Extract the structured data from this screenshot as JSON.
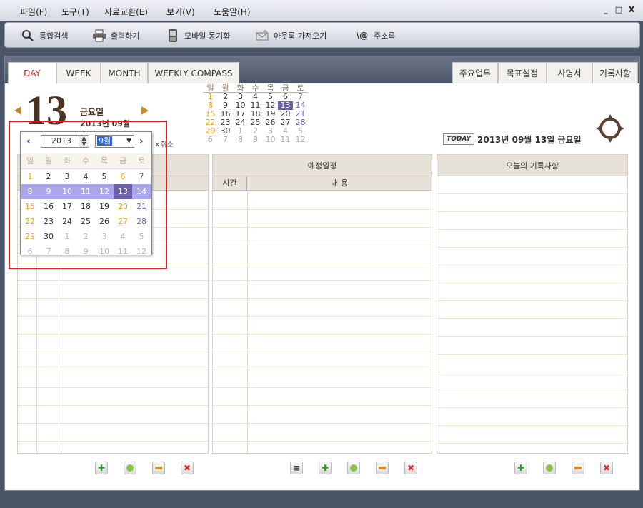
{
  "menubar": {
    "items": [
      "파일(F)",
      "도구(T)",
      "자료교환(E)",
      "보기(V)",
      "도움말(H)"
    ],
    "controls": [
      "_",
      "□",
      "X"
    ]
  },
  "toolbar": {
    "items": [
      {
        "label": "통합검색",
        "icon": "search-icon"
      },
      {
        "label": "출력하기",
        "icon": "printer-icon"
      },
      {
        "label": "모바일 동기화",
        "icon": "mobile-icon"
      },
      {
        "label": "아웃룩 가져오기",
        "icon": "outlook-icon"
      },
      {
        "label": "주소록",
        "icon": "address-book-icon"
      }
    ]
  },
  "tabs_left": [
    "DAY",
    "WEEK",
    "MONTH",
    "WEEKLY COMPASS"
  ],
  "tabs_right": [
    "주요업무",
    "목표설정",
    "사명서",
    "기록사항"
  ],
  "date_header": {
    "day": "13",
    "weekday": "금요일",
    "year_month": "2013년 09월",
    "today_badge": "TODAY",
    "today_text": "2013년 09월 13일 금요일"
  },
  "mini_calendar": {
    "headers": [
      "일",
      "월",
      "화",
      "수",
      "목",
      "금",
      "토"
    ],
    "weeks": [
      [
        "1",
        "2",
        "3",
        "4",
        "5",
        "6",
        "7"
      ],
      [
        "8",
        "9",
        "10",
        "11",
        "12",
        "13",
        "14"
      ],
      [
        "15",
        "16",
        "17",
        "18",
        "19",
        "20",
        "21"
      ],
      [
        "22",
        "23",
        "24",
        "25",
        "26",
        "27",
        "28"
      ],
      [
        "29",
        "30",
        "1",
        "2",
        "3",
        "4",
        "5"
      ],
      [
        "6",
        "7",
        "8",
        "9",
        "10",
        "11",
        "12"
      ]
    ],
    "selected": "13"
  },
  "popup": {
    "year": "2013",
    "month": "9월",
    "cancel_label": "취소",
    "headers": [
      "일",
      "월",
      "화",
      "수",
      "목",
      "금",
      "토"
    ],
    "weeks": [
      [
        "1",
        "2",
        "3",
        "4",
        "5",
        "6",
        "7"
      ],
      [
        "8",
        "9",
        "10",
        "11",
        "12",
        "13",
        "14"
      ],
      [
        "15",
        "16",
        "17",
        "18",
        "19",
        "20",
        "21"
      ],
      [
        "22",
        "23",
        "24",
        "25",
        "26",
        "27",
        "28"
      ],
      [
        "29",
        "30",
        "1",
        "2",
        "3",
        "4",
        "5"
      ],
      [
        "6",
        "7",
        "8",
        "9",
        "10",
        "11",
        "12"
      ]
    ]
  },
  "panels": {
    "schedule": {
      "title": "예정일정",
      "col_time": "시간",
      "col_content": "내 용"
    },
    "notes": {
      "title": "오늘의 기록사항"
    }
  },
  "colors": {
    "sunday": "#e8a020",
    "saturday": "#6a6ab8",
    "selected_bg": "#6a5fa8",
    "week_highlight": "#a9a6ee",
    "red_border": "#e22020"
  }
}
